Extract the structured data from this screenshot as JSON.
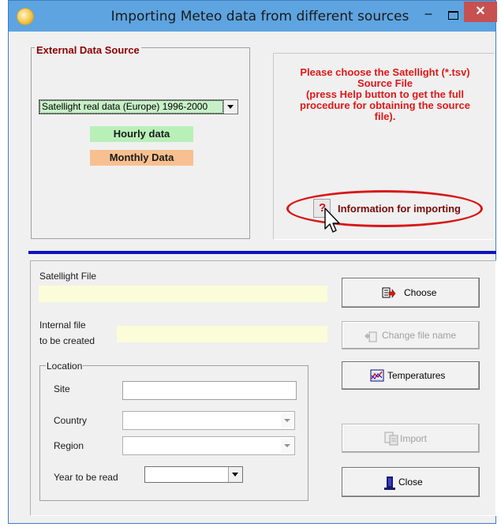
{
  "window": {
    "title": "Importing Meteo data from different sources",
    "minimize_glyph": "–",
    "close_glyph": "✕"
  },
  "external_source": {
    "legend": "External Data Source",
    "selected_source": "Satellight real data (Europe)      1996-2000",
    "hourly_label": "Hourly data",
    "monthly_label": "Monthly Data"
  },
  "message": {
    "lines": [
      "Please choose the Satellight (*.tsv)",
      "Source File",
      "(press Help button to get the full",
      "procedure for obtaining the source",
      "file)."
    ],
    "color": "#e01818",
    "info_button_label": "Information for importing"
  },
  "form": {
    "satellight_file_label": "Satellight File",
    "satellight_file_value": "",
    "internal_file_label_1": "Internal file",
    "internal_file_label_2": "to be created",
    "internal_file_value": "",
    "location_legend": "Location",
    "site_label": "Site",
    "site_value": "",
    "country_label": "Country",
    "country_value": "",
    "region_label": "Region",
    "region_value": "",
    "year_label": "Year to be read",
    "year_value": ""
  },
  "buttons": {
    "choose": "Choose",
    "change_file_name": "Change file name",
    "temperatures": "Temperatures",
    "import": "Import",
    "close": "Close"
  },
  "icons": {
    "app": "sun-icon",
    "choose": "file-arrow-icon",
    "change": "file-rename-icon",
    "temperatures": "chart-icon",
    "import": "import-icon",
    "close": "exit-door-icon",
    "help": "question-icon"
  }
}
